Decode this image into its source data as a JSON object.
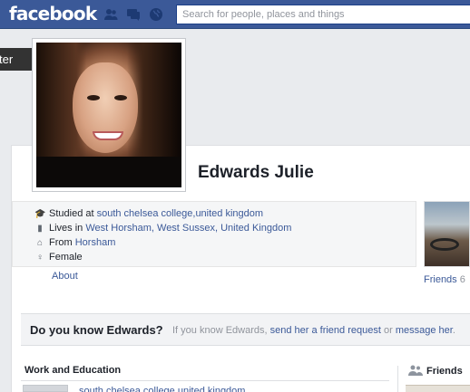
{
  "topbar": {
    "logo": "facebook",
    "search_placeholder": "Search for people, places and things"
  },
  "tooltip": {
    "label": "ter"
  },
  "profile": {
    "name": "Edwards Julie",
    "info": [
      {
        "icon": "graduation-cap-icon",
        "prefix": "Studied at ",
        "links": [
          "south chelsea college,united kingdom"
        ]
      },
      {
        "icon": "building-icon",
        "prefix": "Lives in ",
        "links": [
          "West Horsham, West Sussex, United Kingdom"
        ]
      },
      {
        "icon": "house-icon",
        "prefix": "From ",
        "links": [
          "Horsham"
        ]
      },
      {
        "icon": "female-icon",
        "prefix": "Female",
        "links": []
      }
    ],
    "about_label": "About",
    "friends_label": "Friends",
    "friends_count": "6"
  },
  "know_bar": {
    "title": "Do you know Edwards?",
    "text_before": "If you know Edwards, ",
    "link1": "send her a friend request",
    "text_mid": " or ",
    "link2": "message her",
    "text_after": "."
  },
  "sections": {
    "work_title": "Work and Education",
    "work_item": "south chelsea college,united kingdom",
    "friends_title": "Friends"
  },
  "colors": {
    "brand": "#3b5998",
    "link": "#3b5998",
    "background": "#e9ebee"
  }
}
